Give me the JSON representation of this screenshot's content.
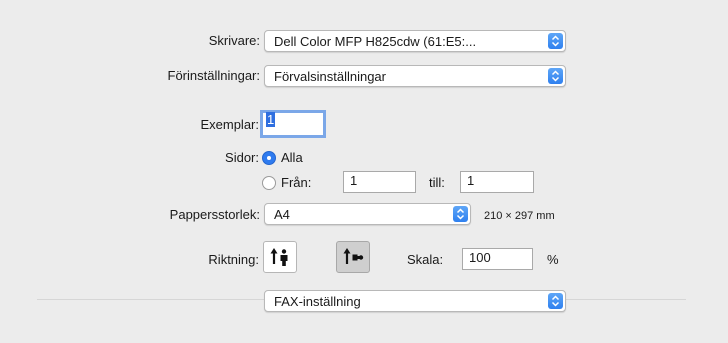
{
  "printer": {
    "label": "Skrivare:",
    "value": "Dell Color MFP H825cdw (61:E5:..."
  },
  "presets": {
    "label": "Förinställningar:",
    "value": "Förvalsinställningar"
  },
  "copies": {
    "label": "Exemplar:",
    "value": "1"
  },
  "pages": {
    "label": "Sidor:",
    "all_label": "Alla",
    "from_label": "Från:",
    "from_value": "1",
    "to_label": "till:",
    "to_value": "1"
  },
  "paper_size": {
    "label": "Pappersstorlek:",
    "value": "A4",
    "dimensions": "210 × 297 mm"
  },
  "orientation": {
    "label": "Riktning:",
    "selected": "landscape"
  },
  "scale": {
    "label": "Skala:",
    "value": "100",
    "unit": "%"
  },
  "section_popup": {
    "value": "FAX-inställning"
  },
  "colors": {
    "accent": "#2f80ef",
    "background": "#ececec"
  }
}
